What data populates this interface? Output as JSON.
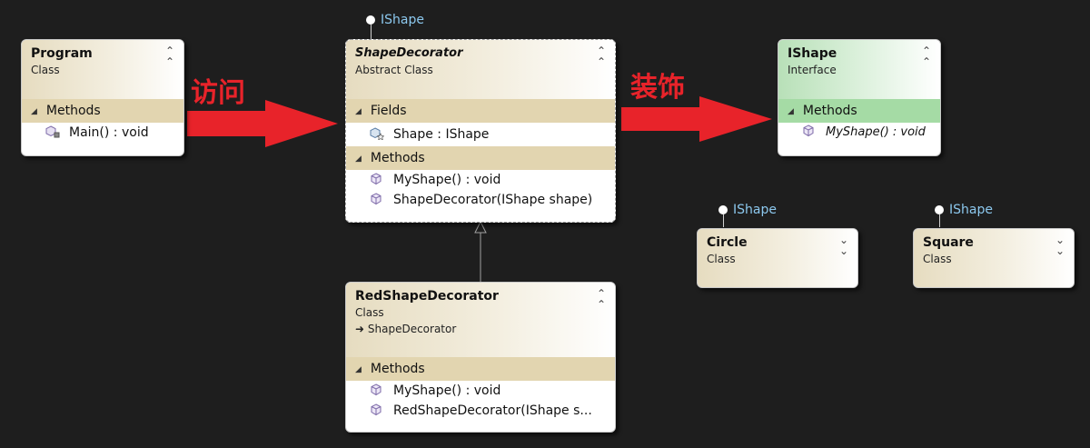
{
  "arrows": {
    "visit_label": "访问",
    "decorate_label": "装饰",
    "color": "#e8232a"
  },
  "program": {
    "name": "Program",
    "kind": "Class",
    "methods_label": "Methods",
    "methods": [
      "Main() : void"
    ]
  },
  "shape_decorator": {
    "lollipop": "IShape",
    "name": "ShapeDecorator",
    "kind": "Abstract Class",
    "fields_label": "Fields",
    "fields": [
      "Shape : IShape"
    ],
    "methods_label": "Methods",
    "methods": [
      "MyShape() : void",
      "ShapeDecorator(IShape shape)"
    ]
  },
  "ishape": {
    "name": "IShape",
    "kind": "Interface",
    "methods_label": "Methods",
    "methods": [
      "MyShape() : void"
    ]
  },
  "circle": {
    "lollipop": "IShape",
    "name": "Circle",
    "kind": "Class"
  },
  "square": {
    "lollipop": "IShape",
    "name": "Square",
    "kind": "Class"
  },
  "red_shape_decorator": {
    "name": "RedShapeDecorator",
    "kind": "Class",
    "base": "ShapeDecorator",
    "methods_label": "Methods",
    "methods": [
      "MyShape() : void",
      "RedShapeDecorator(IShape s..."
    ]
  }
}
